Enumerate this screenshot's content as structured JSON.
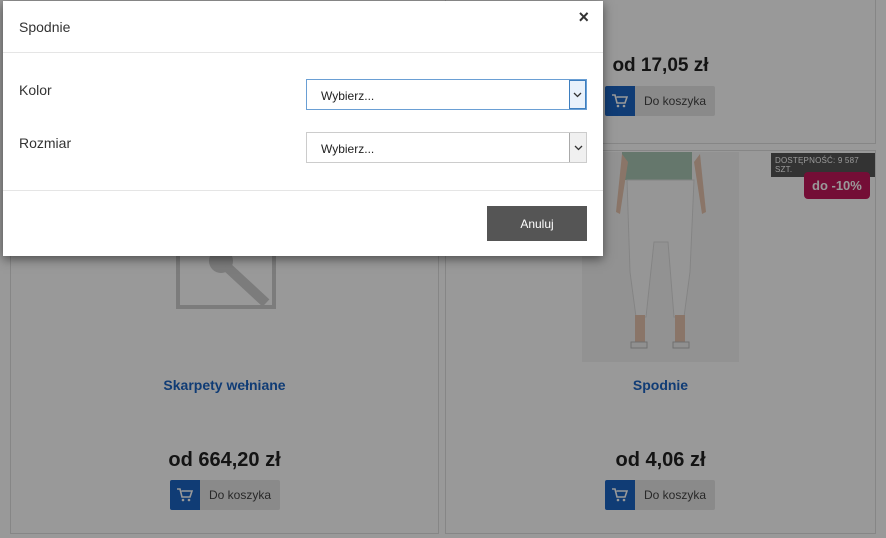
{
  "products": [
    {
      "title": "",
      "price": "od 17,05 zł",
      "cart_label": "Do koszyka"
    },
    {
      "title": "Skarpety wełniane",
      "price": "od 664,20 zł",
      "cart_label": "Do koszyka"
    },
    {
      "title": "Spodnie",
      "price": "od 4,06 zł",
      "cart_label": "Do koszyka",
      "stock_badge": "DOSTĘPNOŚĆ: 9 587 SZT.",
      "discount_badge": "do -10%"
    }
  ],
  "modal": {
    "title": "Spodnie",
    "close_symbol": "×",
    "fields": [
      {
        "label": "Kolor",
        "value": "Wybierz..."
      },
      {
        "label": "Rozmiar",
        "value": "Wybierz..."
      }
    ],
    "cancel_label": "Anuluj"
  },
  "colors": {
    "accent_blue": "#1b64c4",
    "discount_pink": "#c2185b",
    "button_dark": "#555555",
    "overlay": "rgba(0,0,0,0.4)"
  }
}
